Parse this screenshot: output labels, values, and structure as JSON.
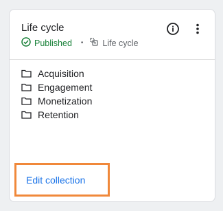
{
  "card": {
    "title": "Life cycle",
    "status": "Published",
    "type": "Life cycle",
    "items": [
      {
        "label": "Acquisition"
      },
      {
        "label": "Engagement"
      },
      {
        "label": "Monetization"
      },
      {
        "label": "Retention"
      }
    ],
    "edit_label": "Edit collection"
  },
  "icons": {
    "info": "info-icon",
    "more": "more-vert-icon",
    "status": "check-circle-icon",
    "type": "collection-icon",
    "item": "folder-icon"
  },
  "colors": {
    "published": "#188038",
    "link": "#1a73e8",
    "highlight": "#f0883a"
  }
}
